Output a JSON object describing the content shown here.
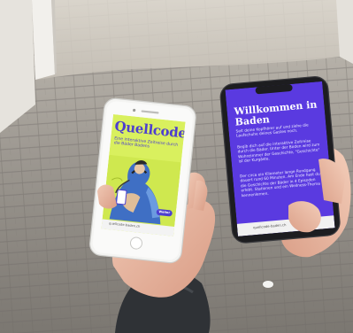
{
  "phone_left": {
    "title": "Quellcode",
    "subtitle": "Eine interaktive Zeitreise durch die Bäder Badens",
    "button_label": "Weiter",
    "url": "quellcode-baden.ch"
  },
  "phone_right": {
    "title": "Willkommen in Baden",
    "para1": "Seit deine Kopfhörer auf und ziehe die Laufschuhe deines Gastes noch.",
    "para2": "Begib dich auf die interaktive Zeitreise durch die Bäder. Unter der Boden wird zum Wohnzimmer der Geschichte, \"Geschichte\" ist der Kurgäste.",
    "para3": "Der circa ein Kilometer lange Rundgang dauert rund 60 Minuten. Am Ende hast du die Geschichte der Bäder in 4 Episoden erlebt. Stationen und ein Wellness-Thema kennenlernen.",
    "url": "quellcode-baden.ch"
  },
  "colors": {
    "accent_purple": "#4d3fcf",
    "accent_lime": "#d9f05e",
    "screen_violet": "#5a3ae0"
  }
}
